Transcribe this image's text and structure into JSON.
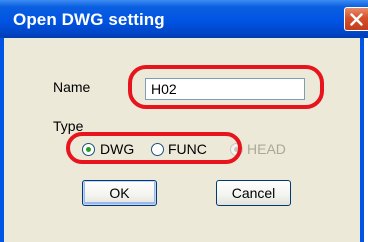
{
  "window": {
    "title": "Open DWG setting",
    "close_icon": "close-icon"
  },
  "form": {
    "name_label": "Name",
    "name_value": "H02",
    "type_label": "Type",
    "type_options": [
      {
        "label": "DWG",
        "selected": true,
        "enabled": true
      },
      {
        "label": "FUNC",
        "selected": false,
        "enabled": true
      },
      {
        "label": "HEAD",
        "selected": true,
        "enabled": false
      }
    ]
  },
  "buttons": {
    "ok_label": "OK",
    "cancel_label": "Cancel"
  },
  "colors": {
    "titlebar": "#0054e3",
    "dialog_face": "#ece9d8",
    "highlight": "#e8141d",
    "radio_check": "#21a121"
  }
}
